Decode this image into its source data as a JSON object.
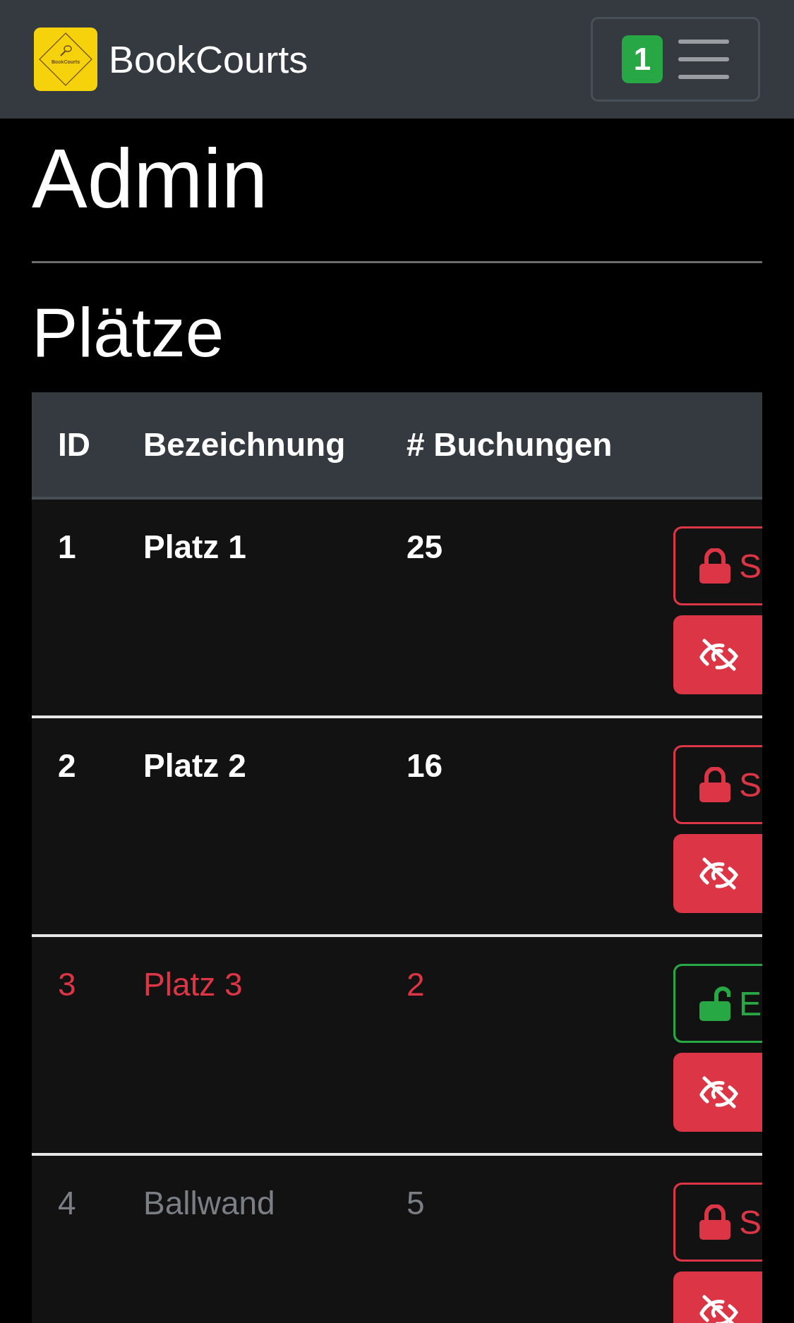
{
  "navbar": {
    "brand": "BookCourts",
    "logo_text": "BookCourts",
    "badge": "1"
  },
  "heading": "Admin",
  "section_title": "Plätze",
  "table": {
    "columns": [
      "ID",
      "Bezeichnung",
      "# Buchungen"
    ],
    "rows": [
      {
        "id": "1",
        "name": "Platz 1",
        "bookings": "25",
        "locked": false,
        "hidden": false,
        "lock_button": "S"
      },
      {
        "id": "2",
        "name": "Platz 2",
        "bookings": "16",
        "locked": false,
        "hidden": false,
        "lock_button": "S"
      },
      {
        "id": "3",
        "name": "Platz 3",
        "bookings": "2",
        "locked": true,
        "hidden": false,
        "lock_button": "E"
      },
      {
        "id": "4",
        "name": "Ballwand",
        "bookings": "5",
        "locked": false,
        "hidden": true,
        "lock_button": "S"
      }
    ]
  }
}
